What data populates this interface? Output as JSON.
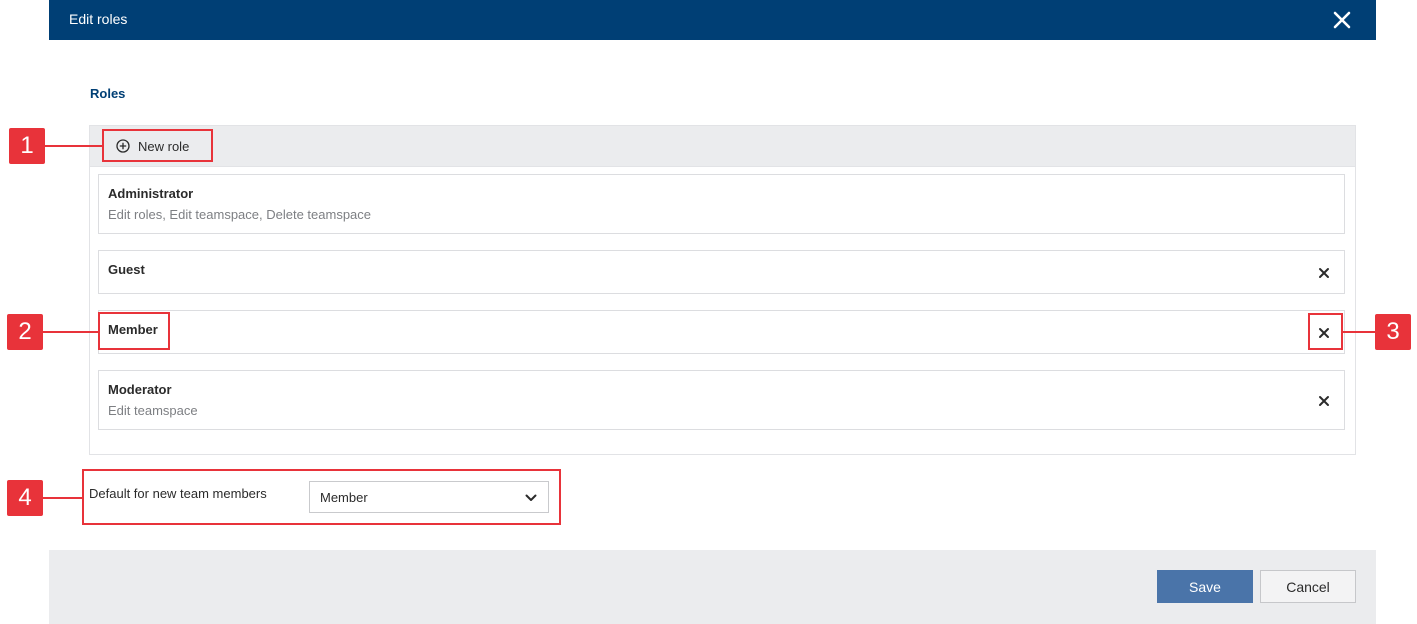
{
  "dialog": {
    "title": "Edit roles",
    "close_icon": "close-icon"
  },
  "roles": {
    "section_label": "Roles",
    "new_role_label": "New role",
    "items": [
      {
        "name": "Administrator",
        "description": "Edit roles, Edit teamspace, Delete teamspace",
        "removable": false
      },
      {
        "name": "Guest",
        "description": "",
        "removable": true
      },
      {
        "name": "Member",
        "description": "",
        "removable": true
      },
      {
        "name": "Moderator",
        "description": "Edit teamspace",
        "removable": true
      }
    ]
  },
  "default_member": {
    "label": "Default for new team members",
    "selected": "Member"
  },
  "footer": {
    "save_label": "Save",
    "cancel_label": "Cancel"
  },
  "callouts": [
    "1",
    "2",
    "3",
    "4"
  ],
  "colors": {
    "header": "#003f75",
    "accent": "#e8333a",
    "save": "#4a74a9"
  }
}
